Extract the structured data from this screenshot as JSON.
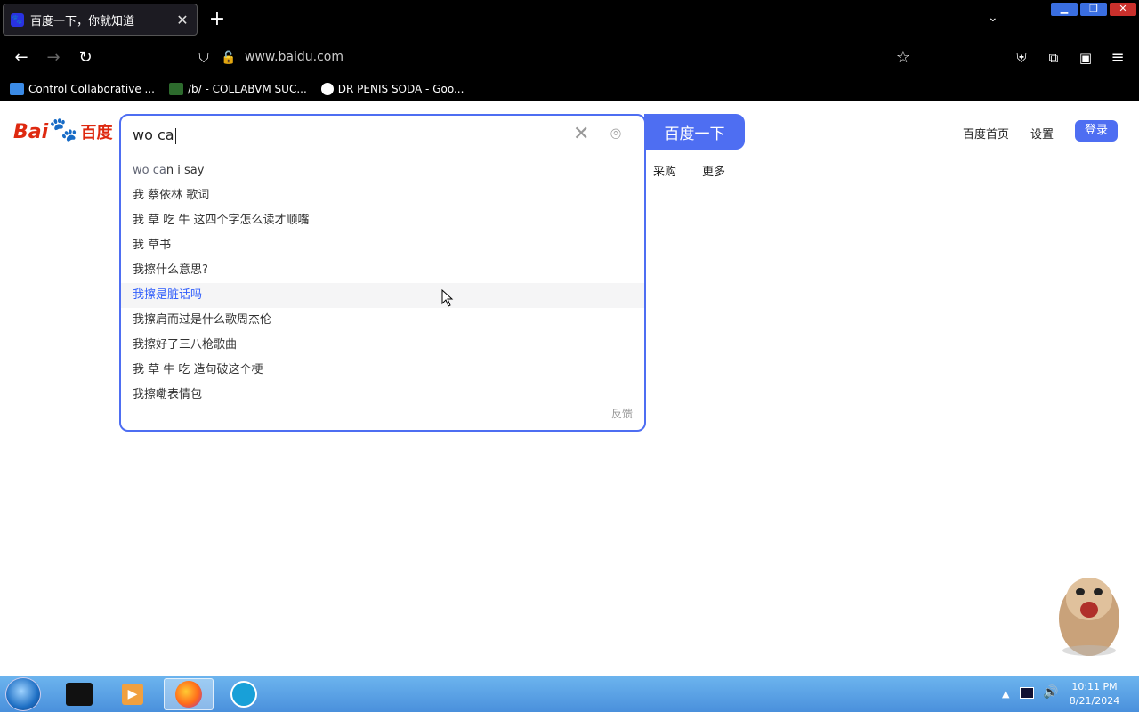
{
  "browser": {
    "tab_title": "百度一下，你就知道",
    "url": "www.baidu.com",
    "bookmarks": [
      {
        "label": "Control Collaborative ..."
      },
      {
        "label": "/b/ - COLLABVM SUC..."
      },
      {
        "label": "DR PENIS SODA - Goo..."
      }
    ]
  },
  "page": {
    "logo_text": "Bai",
    "logo_text2": "du",
    "logo_text3": "百度",
    "search_value": "wo ca",
    "search_button": "百度一下",
    "top_links": {
      "home": "百度首页",
      "settings": "设置",
      "login": "登录"
    },
    "sub_links": {
      "partial": "采购",
      "more": "更多"
    },
    "suggestions": [
      {
        "match": "wo ca",
        "rest": "n i say"
      },
      {
        "match": "",
        "rest": "我 蔡依林 歌词"
      },
      {
        "match": "",
        "rest": "我 草 吃 牛 这四个字怎么读才顺嘴"
      },
      {
        "match": "",
        "rest": "我 草书"
      },
      {
        "match": "",
        "rest": "我擦什么意思?"
      },
      {
        "match": "",
        "rest": "我擦是脏话吗"
      },
      {
        "match": "",
        "rest": "我擦肩而过是什么歌周杰伦"
      },
      {
        "match": "",
        "rest": "我擦好了三八枪歌曲"
      },
      {
        "match": "",
        "rest": "我 草 牛 吃 造句破这个梗"
      },
      {
        "match": "",
        "rest": "我擦嘞表情包"
      }
    ],
    "feedback": "反馈"
  },
  "taskbar": {
    "time": "10:11 PM",
    "date": "8/21/2024"
  },
  "colors": {
    "accent": "#4e6ef2",
    "highlight_text": "#315efb"
  }
}
